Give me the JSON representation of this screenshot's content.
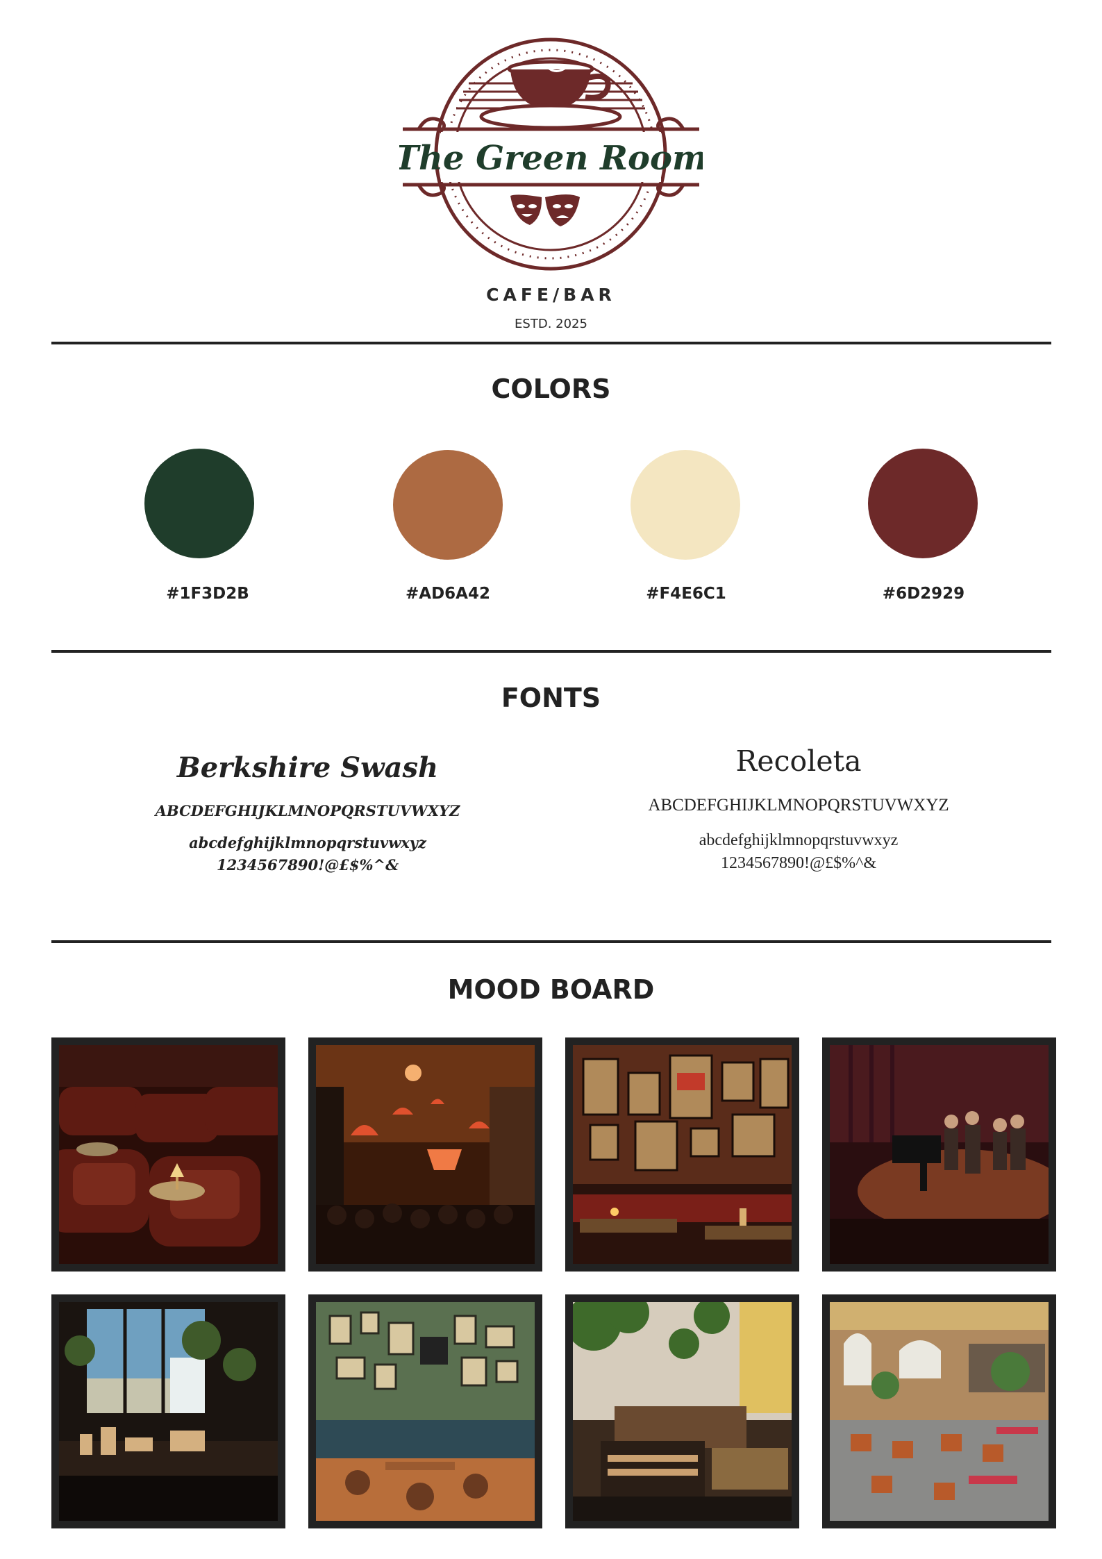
{
  "logo": {
    "name": "The Green Room",
    "tagline": "CAFE/BAR",
    "established": "ESTD. 2025"
  },
  "colors": {
    "title": "COLORS",
    "swatches": [
      {
        "hex": "#1F3D2B",
        "label": "#1F3D2B"
      },
      {
        "hex": "#AD6A42",
        "label": "#AD6A42"
      },
      {
        "hex": "#F4E6C1",
        "label": "#F4E6C1"
      },
      {
        "hex": "#6D2929",
        "label": "#6D2929"
      }
    ]
  },
  "fonts": {
    "title": "FONTS",
    "primary": {
      "name": "Berkshire Swash",
      "uppercase": "ABCDEFGHIJKLMNOPQRSTUVWXYZ",
      "lowercase": "abcdefghijklmnopqrstuvwxyz",
      "numbers": "1234567890!@£$%^&"
    },
    "secondary": {
      "name": "Recoleta",
      "uppercase": "ABCDEFGHIJKLMNOPQRSTUVWXYZ",
      "lowercase": "abcdefghijklmnopqrstuvwxyz",
      "numbers": "1234567890!@£$%^&"
    }
  },
  "mood_board": {
    "title": "MOOD BOARD",
    "images": [
      "cinema-lounge-leather-armchairs-icon",
      "bar-with-red-lanterns-crowd-icon",
      "poster-wall-booth-candle-icon",
      "jazz-band-stage-icon",
      "coffee-counter-window-plants-icon",
      "green-walled-pub-frames-icon",
      "plant-filled-lounge-records-icon",
      "arched-window-cafe-hall-icon"
    ]
  }
}
